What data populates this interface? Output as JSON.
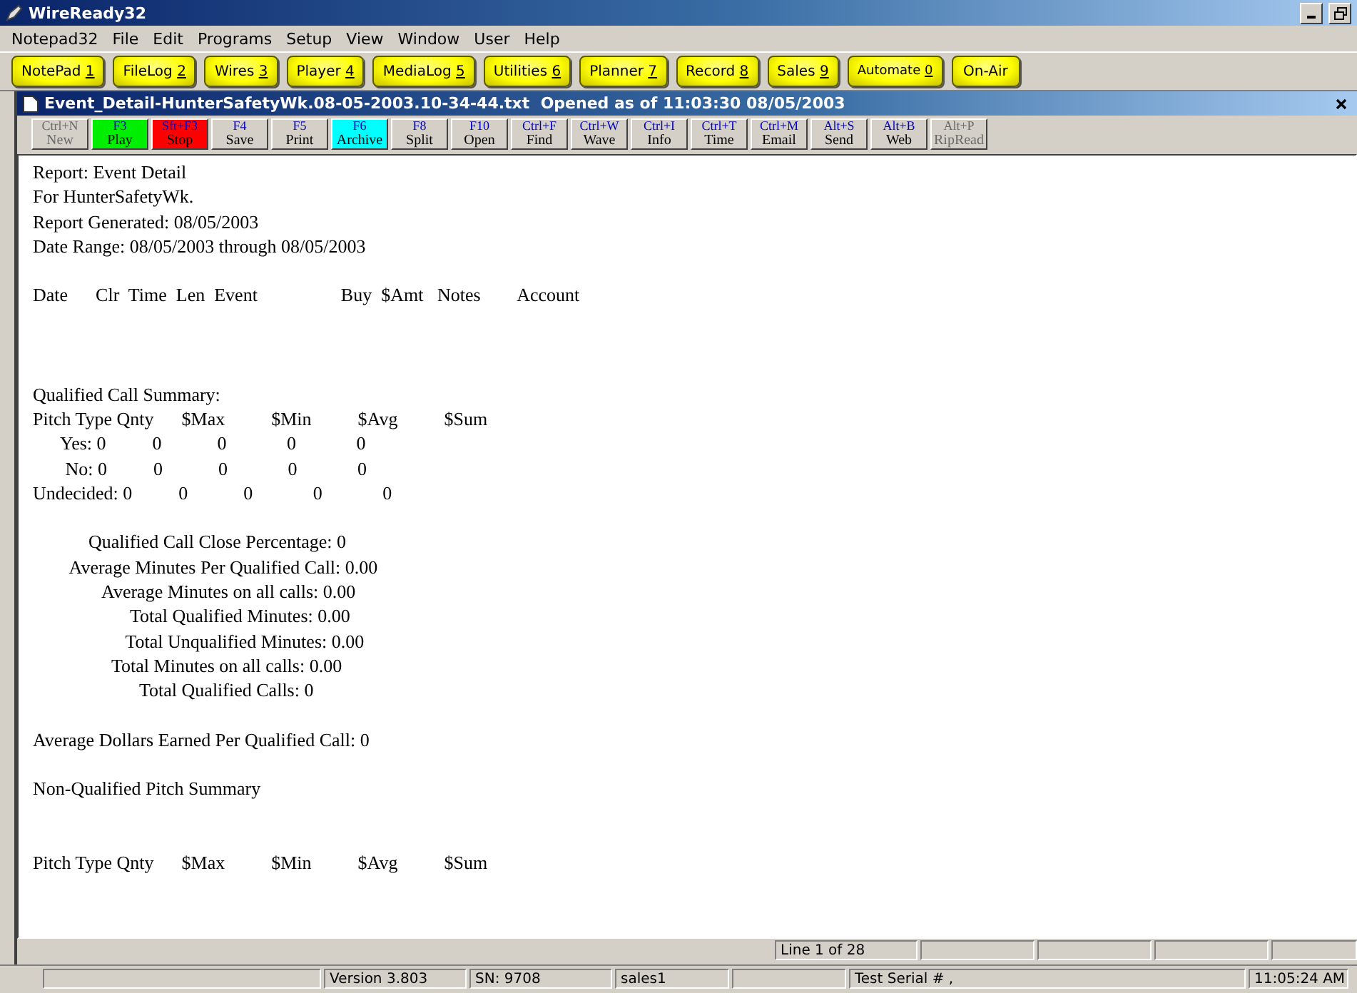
{
  "app": {
    "title": "WireReady32"
  },
  "menu": [
    "Notepad32",
    "File",
    "Edit",
    "Programs",
    "Setup",
    "View",
    "Window",
    "User",
    "Help"
  ],
  "modules": [
    {
      "label": "NotePad",
      "key": "1"
    },
    {
      "label": "FileLog",
      "key": "2"
    },
    {
      "label": "Wires",
      "key": "3"
    },
    {
      "label": "Player",
      "key": "4"
    },
    {
      "label": "MediaLog",
      "key": "5"
    },
    {
      "label": "Utilities",
      "key": "6"
    },
    {
      "label": "Planner",
      "key": "7"
    },
    {
      "label": "Record",
      "key": "8"
    },
    {
      "label": "Sales",
      "key": "9"
    },
    {
      "label": "Automate",
      "key": "0"
    },
    {
      "label": "On-Air"
    }
  ],
  "document": {
    "title": "Event_Detail-HunterSafetyWk.08-05-2003.10-34-44.txt  Opened as of 11:03:30 08/05/2003"
  },
  "tools": [
    {
      "key": "Ctrl+N",
      "label": "New",
      "disabled": true,
      "color": "#d4d0c8"
    },
    {
      "key": "F3",
      "label": "Play",
      "disabled": false,
      "color": "#00ee00"
    },
    {
      "key": "Sft+F3",
      "label": "Stop",
      "disabled": false,
      "color": "#ff0000"
    },
    {
      "key": "F4",
      "label": "Save",
      "disabled": false,
      "color": "#d4d0c8"
    },
    {
      "key": "F5",
      "label": "Print",
      "disabled": false,
      "color": "#d4d0c8"
    },
    {
      "key": "F6",
      "label": "Archive",
      "disabled": false,
      "color": "#00ffff"
    },
    {
      "key": "F8",
      "label": "Split",
      "disabled": false,
      "color": "#d4d0c8"
    },
    {
      "key": "F10",
      "label": "Open",
      "disabled": false,
      "color": "#d4d0c8"
    },
    {
      "key": "Ctrl+F",
      "label": "Find",
      "disabled": false,
      "color": "#d4d0c8"
    },
    {
      "key": "Ctrl+W",
      "label": "Wave",
      "disabled": false,
      "color": "#d4d0c8"
    },
    {
      "key": "Ctrl+I",
      "label": "Info",
      "disabled": false,
      "color": "#d4d0c8"
    },
    {
      "key": "Ctrl+T",
      "label": "Time",
      "disabled": false,
      "color": "#d4d0c8"
    },
    {
      "key": "Ctrl+M",
      "label": "Email",
      "disabled": false,
      "color": "#d4d0c8"
    },
    {
      "key": "Alt+S",
      "label": "Send",
      "disabled": false,
      "color": "#d4d0c8"
    },
    {
      "key": "Alt+B",
      "label": "Web",
      "disabled": false,
      "color": "#d4d0c8"
    },
    {
      "key": "Alt+P",
      "label": "RipRead",
      "disabled": true,
      "color": "#d4d0c8"
    }
  ],
  "lines": [
    {
      "kind": "text",
      "text": "Report: Event Detail"
    },
    {
      "kind": "text",
      "text": "For HunterSafetyWk."
    },
    {
      "kind": "text",
      "text": "Report Generated: 08/05/2003"
    },
    {
      "kind": "text",
      "text": "Date Range: 08/05/2003 through 08/05/2003"
    },
    {
      "kind": "blank"
    },
    {
      "kind": "text",
      "text": "Date      Clr  Time  Len  Event                  Buy  $Amt   Notes        Account"
    },
    {
      "kind": "blank"
    },
    {
      "kind": "blank"
    },
    {
      "kind": "blank"
    },
    {
      "kind": "text",
      "text": "Qualified Call Summary:"
    },
    {
      "kind": "text",
      "text": "Pitch Type Qnty      $Max          $Min          $Avg          $Sum"
    },
    {
      "kind": "text",
      "text": "      Yes: 0          0            0             0             0"
    },
    {
      "kind": "text",
      "text": "       No: 0          0            0             0             0"
    },
    {
      "kind": "text",
      "text": "Undecided: 0          0            0             0             0"
    },
    {
      "kind": "blank"
    },
    {
      "kind": "text",
      "text": "            Qualified Call Close Percentage: 0"
    },
    {
      "kind": "text",
      "text": "        Average Minutes Per Qualified Call: 0.00"
    },
    {
      "kind": "text",
      "text": "               Average Minutes on all calls: 0.00"
    },
    {
      "kind": "text",
      "text": "                     Total Qualified Minutes: 0.00"
    },
    {
      "kind": "text",
      "text": "                    Total Unqualified Minutes: 0.00"
    },
    {
      "kind": "text",
      "text": "                 Total Minutes on all calls: 0.00"
    },
    {
      "kind": "text",
      "text": "                       Total Qualified Calls: 0"
    },
    {
      "kind": "blank"
    },
    {
      "kind": "text",
      "text": "Average Dollars Earned Per Qualified Call: 0"
    },
    {
      "kind": "blank"
    },
    {
      "kind": "text",
      "text": "Non-Qualified Pitch Summary"
    },
    {
      "kind": "blank"
    },
    {
      "kind": "blank"
    },
    {
      "kind": "text",
      "text": "Pitch Type Qnty      $Max          $Min          $Avg          $Sum"
    }
  ],
  "doc_status": {
    "position": "Line 1 of 28"
  },
  "status_bar": [
    {
      "text": "Version 3.803"
    },
    {
      "text": "SN: 9708"
    },
    {
      "text": "sales1"
    },
    {
      "text": "Test Serial #  ,"
    },
    {
      "text": "11:05:24 AM"
    }
  ]
}
